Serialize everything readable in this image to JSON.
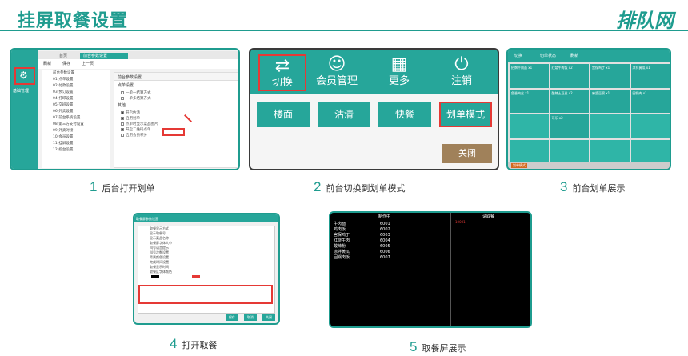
{
  "header": {
    "title": "挂屏取餐设置",
    "logo": "排队网"
  },
  "captions": [
    {
      "num": "1",
      "text": "后台打开划单"
    },
    {
      "num": "2",
      "text": "前台切换到划单模式"
    },
    {
      "num": "3",
      "text": "前台划单展示"
    },
    {
      "num": "4",
      "text": "打开取餐"
    },
    {
      "num": "5",
      "text": "取餐屏展示"
    }
  ],
  "backend": {
    "side_label": "基础管理",
    "tabs": [
      "首页",
      "前台参数设置"
    ],
    "toolbar": [
      "刷新",
      "保存",
      "上一页"
    ],
    "tree": [
      "前台参数设置",
      "01-点单设置",
      "02-付款设置",
      "03-预订设置",
      "04-打印设置",
      "05-交班设置",
      "06-外卖设置",
      "07-前台系统设置",
      "08-第三方支付设置",
      "09-外卖对接",
      "10-会员设置",
      "11-挂屏设置",
      "12-控台设置"
    ],
    "form_title": "前台参数设置",
    "section_1": "点单设置",
    "section_2": "其他",
    "rows": [
      {
        "label": "一单一结算方式",
        "checked": false
      },
      {
        "label": "一单多结算方式",
        "checked": false
      },
      {
        "label": "开启估清",
        "checked": true
      },
      {
        "label": "启用划单",
        "checked": true
      },
      {
        "label": "点单时显示菜品图片",
        "checked": false
      },
      {
        "label": "开启二维码点单",
        "checked": true
      },
      {
        "label": "启用会员积分",
        "checked": false
      }
    ]
  },
  "frontend": {
    "top_buttons": [
      {
        "icon": "switch-icon",
        "glyph": "⇄",
        "label": "切换",
        "selected": true
      },
      {
        "icon": "member-icon",
        "glyph": "☺",
        "label": "会员管理",
        "selected": false
      },
      {
        "icon": "more-icon",
        "glyph": "▦",
        "label": "更多",
        "selected": false
      },
      {
        "icon": "power-icon",
        "glyph": "⏻",
        "label": "注销",
        "selected": false
      }
    ],
    "actions": [
      {
        "label": "楼面",
        "selected": false
      },
      {
        "label": "沽清",
        "selected": false
      },
      {
        "label": "快餐",
        "selected": false
      },
      {
        "label": "划单模式",
        "selected": true
      }
    ],
    "close_label": "关闭"
  },
  "board": {
    "top": [
      "切换",
      "切单状态",
      "刷新"
    ],
    "cells": [
      "招牌牛肉面 x1",
      "红烧牛肉饭 x2",
      "宫保鸡丁 x1",
      "凉拌黄瓜 x1",
      "鱼香肉丝 x1",
      "酸辣土豆丝 x2",
      "麻婆豆腐 x1",
      "回锅肉 x1",
      "",
      "可乐 x2",
      "",
      "",
      "",
      "",
      "",
      ""
    ],
    "footer": "划单模式"
  },
  "pickup_settings": {
    "title": "取餐屏参数设置",
    "rows": [
      "取餐显示方式",
      "显示取餐号",
      "显示菜品名称",
      "取餐屏字体大小",
      "叫号语音提示",
      "叫号次数设置",
      "背景颜色设置",
      "完成时间设置",
      "取餐显示时间",
      "取餐区字体颜色"
    ],
    "buttons": [
      "保存",
      "取消",
      "关闭"
    ]
  },
  "pickup_screen": {
    "left_header": "制作中",
    "right_header": "请取餐",
    "called": "10001",
    "items": [
      {
        "name": "牛肉面",
        "no": "6001"
      },
      {
        "name": "鸡肉饭",
        "no": "6002"
      },
      {
        "name": "宫保鸡丁",
        "no": "6003"
      },
      {
        "name": "红烧牛肉",
        "no": "6004"
      },
      {
        "name": "酸辣粉",
        "no": "6005"
      },
      {
        "name": "凉拌黄瓜",
        "no": "6006"
      },
      {
        "name": "回锅肉饭",
        "no": "6007"
      }
    ]
  }
}
